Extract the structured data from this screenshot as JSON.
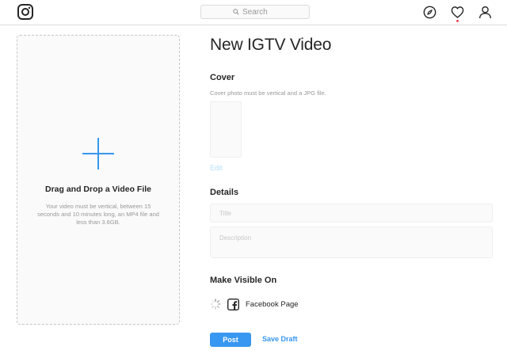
{
  "topbar": {
    "logo_icon": "instagram-logo-icon",
    "search_placeholder": "Search",
    "icons": [
      "compass-icon",
      "heart-icon",
      "profile-icon"
    ],
    "notification_color": "#ed4956"
  },
  "upload": {
    "plus_icon": "plus-icon",
    "title": "Drag and Drop a Video File",
    "description": "Your video must be vertical, between 15 seconds and 10 minutes long, an MP4 file and less than 3.6GB."
  },
  "form": {
    "page_title": "New IGTV Video",
    "cover": {
      "heading": "Cover",
      "note": "Cover photo must be vertical and a JPG file.",
      "edit_label": "Edit"
    },
    "details": {
      "heading": "Details",
      "title_placeholder": "Title",
      "title_value": "",
      "description_placeholder": "Description",
      "description_value": ""
    },
    "visibility": {
      "heading": "Make Visible On",
      "spinner_icon": "loading-spinner-icon",
      "facebook_icon": "facebook-icon",
      "facebook_label": "Facebook Page"
    },
    "actions": {
      "post_label": "Post",
      "save_draft_label": "Save Draft"
    }
  },
  "colors": {
    "accent": "#3897f0",
    "accent_light": "#b2dffc",
    "text": "#262626",
    "muted": "#999999",
    "border": "#dbdbdb"
  }
}
